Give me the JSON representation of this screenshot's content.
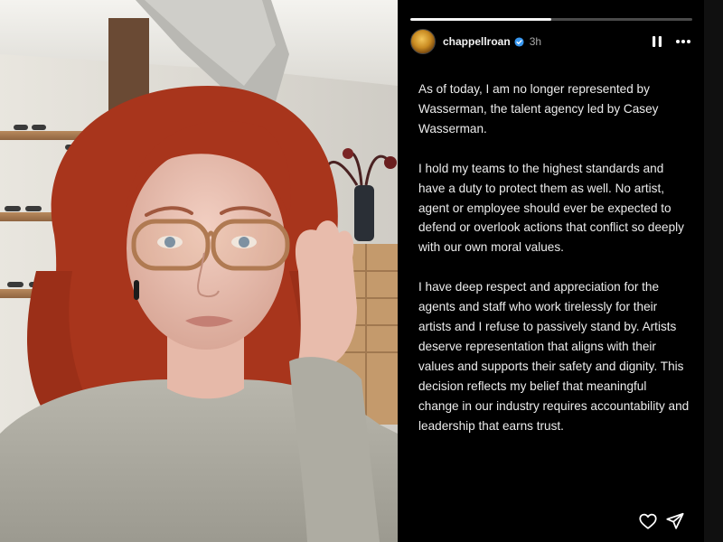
{
  "story": {
    "username": "chappellroan",
    "time_ago": "3h",
    "progress": 0.5,
    "verified_icon": "verified-badge-icon",
    "controls": {
      "pause_icon": "pause-icon",
      "more_icon": "more-options-icon"
    },
    "caption_paragraphs": [
      "As of today, I am no longer represented by Wasserman, the talent agency led by Casey Wasserman.",
      "I hold my teams to the highest standards and have a duty to protect them as well. No artist, agent or employee should ever be expected to defend or overlook actions that conflict so deeply with our own moral values.",
      "I have deep respect and appreciation for the agents and staff who work tirelessly for their artists and I refuse to passively stand by. Artists deserve representation that aligns with their values and supports their safety and dignity. This decision reflects my belief that meaningful change in our industry requires accountability and leadership that earns trust."
    ],
    "footer": {
      "like_icon": "heart-icon",
      "share_icon": "send-icon"
    }
  },
  "photo": {
    "subject": "selfie-photo"
  },
  "colors": {
    "background": "#000000",
    "text": "#ececec",
    "muted": "#a8a8a8",
    "progress_track": "#4a4a4a",
    "progress_fill": "#f5f5f5",
    "verified": "#3897f0"
  }
}
